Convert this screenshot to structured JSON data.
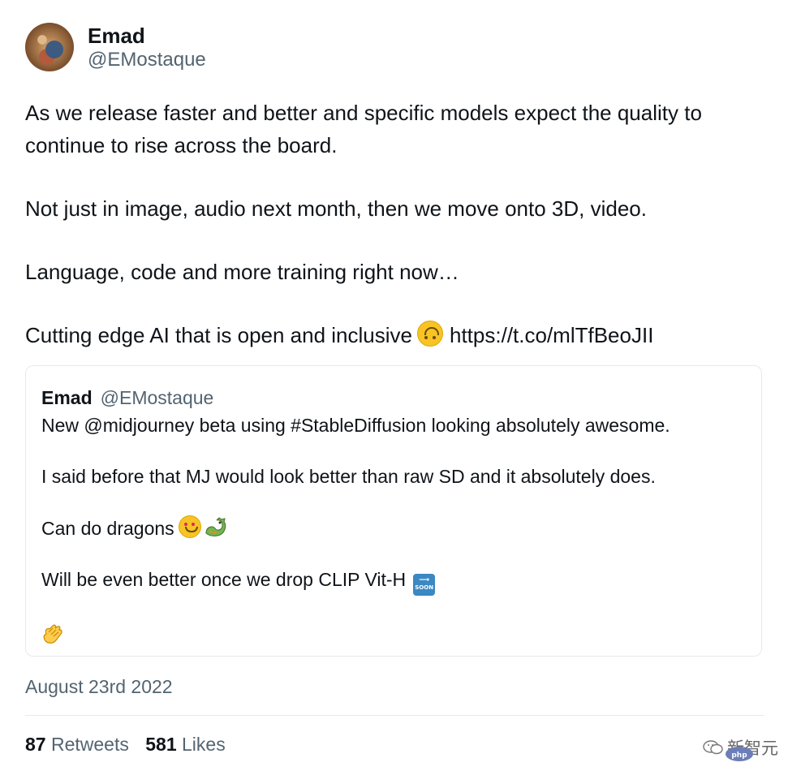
{
  "author": {
    "display_name": "Emad",
    "handle": "@EMostaque"
  },
  "tweet": {
    "line1": "As we release faster and better and specific models expect the quality to continue to rise across the board.",
    "line2": "Not just in image, audio next month, then we move onto 3D, video.",
    "line3": "Language, code and more training right now…",
    "line4_text": "Cutting edge AI that is open and inclusive",
    "line4_emoji": "upside-down-face-emoji",
    "link": "https://t.co/mlTfBeoJII"
  },
  "quoted_tweet": {
    "display_name": "Emad",
    "handle": "@EMostaque",
    "line1": "New @midjourney beta using #StableDiffusion looking absolutely awesome.",
    "line2": "I said before that MJ would look better than raw SD and it absolutely does.",
    "line3": "Can do dragons",
    "line3_emojis": [
      "smiling-face-with-hearts-emoji",
      "dragon-emoji"
    ],
    "line4": "Will be even better once we drop CLIP Vit-H",
    "line4_emoji": "soon-arrow-emoji",
    "line5_emoji": "clapping-hands-emoji",
    "soon_label": "SOON"
  },
  "timestamp": "August 23rd 2022",
  "stats": {
    "retweets_count": "87",
    "retweets_label": "Retweets",
    "likes_count": "581",
    "likes_label": "Likes"
  },
  "watermark": {
    "text": "新智元",
    "badge": "php中文网"
  },
  "colors": {
    "text": "#0f1419",
    "secondary": "#536471",
    "border": "#e6e9ec"
  }
}
